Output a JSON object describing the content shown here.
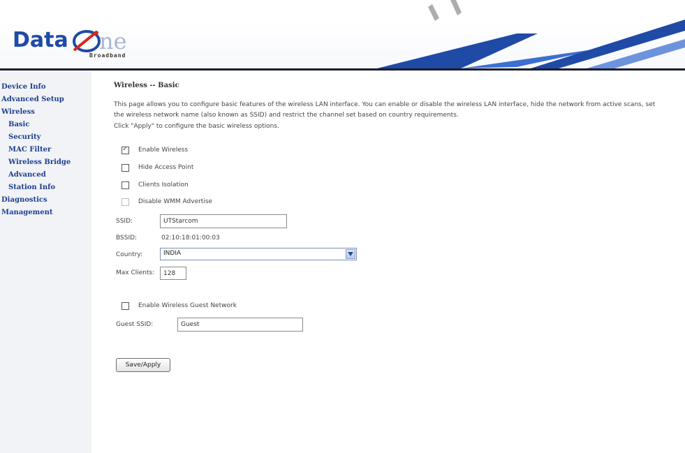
{
  "header": {
    "logo_text_primary": "Data",
    "logo_text_secondary": "ne",
    "logo_tagline": "Broadband"
  },
  "sidebar": {
    "items": [
      {
        "label": "Device Info"
      },
      {
        "label": "Advanced Setup"
      },
      {
        "label": "Wireless"
      },
      {
        "label": "Basic"
      },
      {
        "label": "Security"
      },
      {
        "label": "MAC Filter"
      },
      {
        "label": "Wireless Bridge"
      },
      {
        "label": "Advanced"
      },
      {
        "label": "Station Info"
      },
      {
        "label": "Diagnostics"
      },
      {
        "label": "Management"
      }
    ]
  },
  "main": {
    "title": "Wireless -- Basic",
    "description": [
      "This page allows you to configure basic features of the wireless LAN interface. You can enable or disable the wireless LAN interface, hide the network from active scans, set",
      "the wireless network name (also known as SSID) and restrict the channel set based on country requirements.",
      "Click \"Apply\" to configure the basic wireless options."
    ],
    "options": [
      {
        "label": "Enable Wireless",
        "checked": true,
        "disabled": false
      },
      {
        "label": "Hide Access Point",
        "checked": false,
        "disabled": false
      },
      {
        "label": "Clients Isolation",
        "checked": false,
        "disabled": false
      },
      {
        "label": "Disable WMM Advertise",
        "checked": false,
        "disabled": true
      }
    ],
    "ssid_label": "SSID:",
    "ssid_value": "UTStarcom",
    "bssid_label": "BSSID:",
    "bssid_value": "02:10:18:01:00:03",
    "country_label": "Country:",
    "country_value": "INDIA",
    "max_clients_label": "Max Clients:",
    "max_clients_value": "128",
    "guest_option_label": "Enable Wireless Guest Network",
    "guest_option_checked": false,
    "guest_ssid_label": "Guest SSID:",
    "guest_ssid_value": "Guest",
    "save_label": "Save/Apply"
  },
  "colors": {
    "nav_link": "#1b3f8f",
    "header_rule": "#1a1d2e",
    "sidebar_bg": "#f2f3f6",
    "brand_blue": "#1f4aa6"
  }
}
